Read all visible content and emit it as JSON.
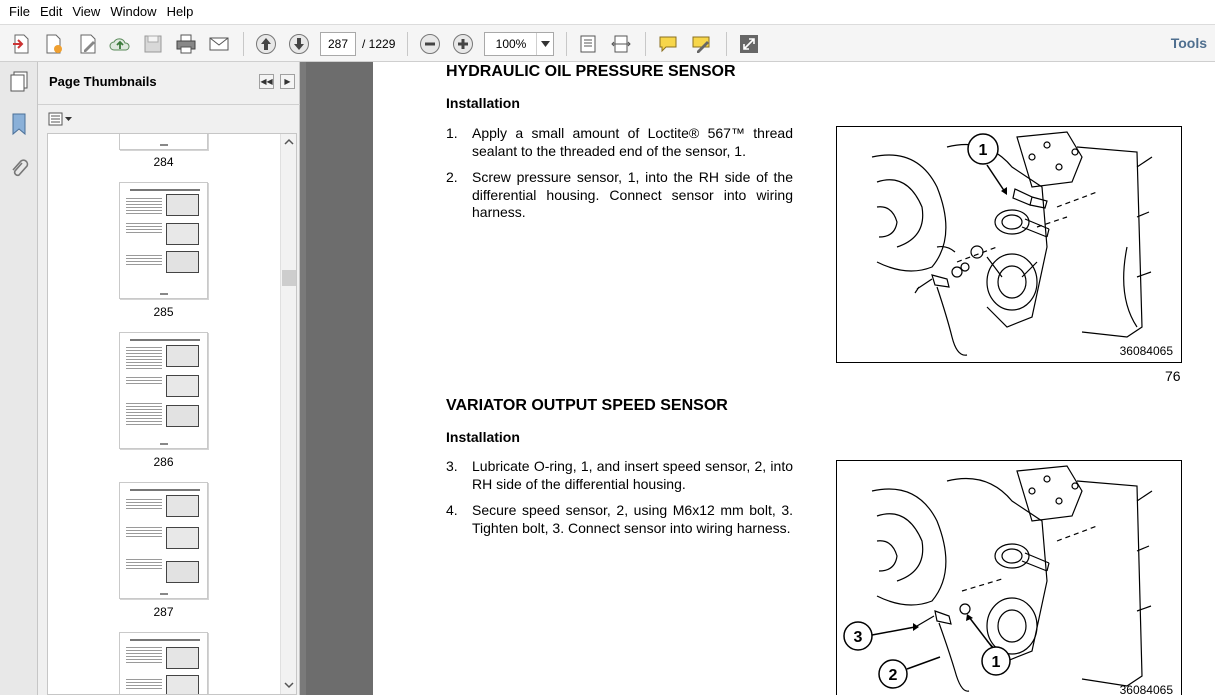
{
  "menu": [
    "File",
    "Edit",
    "View",
    "Window",
    "Help"
  ],
  "toolbar": {
    "current_page": "287",
    "total_pages": "/ 1229",
    "zoom": "100%",
    "tools_label": "Tools"
  },
  "thumbnails_panel": {
    "title": "Page Thumbnails",
    "pages": [
      "284",
      "285",
      "286",
      "287"
    ]
  },
  "document": {
    "section1": {
      "title": "HYDRAULIC OIL PRESSURE SENSOR",
      "subtitle": "Installation",
      "steps": [
        {
          "num": "1.",
          "text": "Apply a small amount of Loctite® 567™ thread sealant to the threaded end of the sensor, 1."
        },
        {
          "num": "2.",
          "text": "Screw pressure sensor, 1, into the RH side of the differential housing. Connect sensor into wiring harness."
        }
      ],
      "figure_code": "36084065",
      "figure_callouts": [
        "1"
      ],
      "figure_number": "76"
    },
    "section2": {
      "title": "VARIATOR OUTPUT SPEED SENSOR",
      "subtitle": "Installation",
      "steps": [
        {
          "num": "3.",
          "text": "Lubricate O-ring, 1, and insert speed sensor, 2, into RH side of the differential housing."
        },
        {
          "num": "4.",
          "text": "Secure speed sensor, 2, using M6x12 mm bolt, 3. Tighten bolt, 3. Connect sensor into wiring harness."
        }
      ],
      "figure_code": "36084065",
      "figure_callouts": [
        "3",
        "2",
        "1"
      ]
    }
  },
  "colors": {
    "toolbar_bg": "#f5f5f5",
    "doc_background": "#6d6d6d",
    "tools_link": "#4f6f8f",
    "nav_arrow": "#e8e8e8"
  },
  "icons": {
    "toolbar": [
      "create-pdf-icon",
      "create-edit-icon",
      "edit-pdf-icon",
      "cloud-upload-icon",
      "save-icon",
      "print-icon",
      "email-icon",
      "previous-page-icon",
      "next-page-icon",
      "zoom-out-icon",
      "zoom-in-icon",
      "fit-page-icon",
      "fit-width-icon",
      "comment-icon",
      "sign-icon",
      "fullscreen-icon"
    ],
    "rail": [
      "thumbnails-icon",
      "bookmark-icon",
      "attachment-icon"
    ]
  }
}
